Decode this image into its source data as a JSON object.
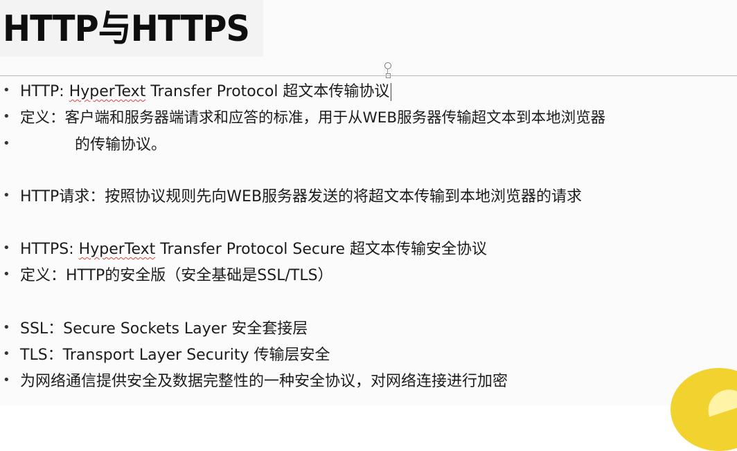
{
  "slide": {
    "title": "HTTP与HTTPS",
    "lines": [
      {
        "bullet": "•",
        "parts": [
          "HTTP: ",
          "HyperText",
          " Transfer Protocol 超文本传输协议"
        ]
      },
      {
        "bullet": "•",
        "text": "定义：客户端和服务器端请求和应答的标准，用于从WEB服务器传输超文本到本地浏览器"
      },
      {
        "bullet": "•",
        "text": "的传输协议。"
      },
      {
        "bullet": "•",
        "text": "HTTP请求：按照协议规则先向WEB服务器发送的将超文本传输到本地浏览器的请求"
      },
      {
        "bullet": "•",
        "parts": [
          "HTTPS:  ",
          "HyperText",
          " Transfer Protocol Secure 超文本传输安全协议"
        ]
      },
      {
        "bullet": "•",
        "text": "定义：HTTP的安全版（安全基础是SSL/TLS）"
      },
      {
        "bullet": "•",
        "text": "SSL：Secure Sockets Layer  安全套接层"
      },
      {
        "bullet": "•",
        "text": "TLS：Transport Layer Security 传输层安全"
      },
      {
        "bullet": "•",
        "text": "为网络通信提供安全及数据完整性的一种安全协议，对网络连接进行加密"
      }
    ]
  },
  "colors": {
    "background": "#fbfbfb",
    "title_bar": "#f3f3f3",
    "spell_underline": "#e04040",
    "corner_logo": "#f2d22e"
  }
}
